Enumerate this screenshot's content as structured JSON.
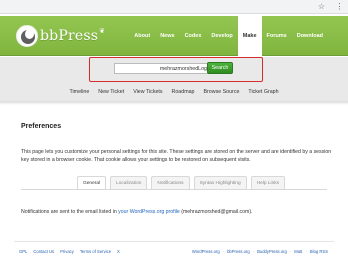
{
  "browser": {
    "icons": [
      "star-icon",
      "ellipsis-icon"
    ]
  },
  "header": {
    "logo_text": "bbPress",
    "nav": [
      {
        "label": "About"
      },
      {
        "label": "News"
      },
      {
        "label": "Codex"
      },
      {
        "label": "Develop"
      },
      {
        "label": "Make",
        "active": true
      },
      {
        "label": "Forums"
      },
      {
        "label": "Download"
      }
    ]
  },
  "search": {
    "value": "mehrazmorshedLog",
    "button_label": "Search"
  },
  "subnav": [
    {
      "label": "Timeline"
    },
    {
      "label": "New Ticket"
    },
    {
      "label": "View Tickets"
    },
    {
      "label": "Roadmap"
    },
    {
      "label": "Browse Source"
    },
    {
      "label": "Ticket Graph"
    }
  ],
  "main": {
    "title": "Preferences",
    "intro": "This page lets you customize your personal settings for this site. These settings are stored on the server and are identified by a session key stored in a browser cookie. That cookie allows your settings to be restored on subsequent visits.",
    "tabs": [
      {
        "label": "General",
        "active": true
      },
      {
        "label": "Localization"
      },
      {
        "label": "Notifications"
      },
      {
        "label": "Syntax Highlighting"
      },
      {
        "label": "Help Links"
      }
    ],
    "notification_prefix": "Notifications are sent to the email listed in ",
    "notification_link": "your WordPress.org profile",
    "notification_suffix": " (mehrazmorshed@gmail.com)."
  },
  "footer": {
    "left": [
      "GPL",
      "Contact Us",
      "Privacy",
      "Terms of Service",
      "X"
    ],
    "right": [
      "WordPress.org",
      "bbPress.org",
      "BuddyPress.org",
      "Matt",
      "Blog RSS"
    ]
  },
  "colors": {
    "header_green": "#8bc14a",
    "search_button": "#3c9b2c",
    "highlight_red": "#d62b2b",
    "link_blue": "#2266bb"
  }
}
